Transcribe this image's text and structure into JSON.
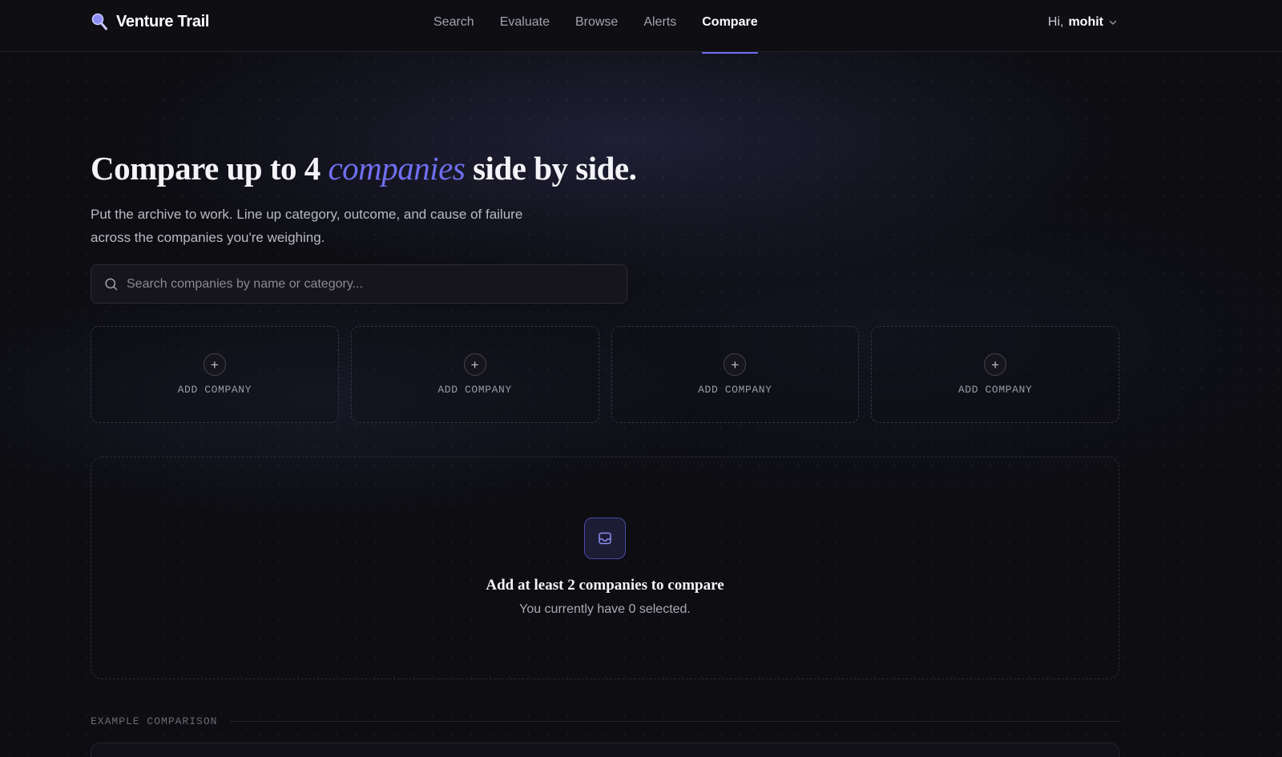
{
  "brand": {
    "name": "Venture Trail",
    "icon": "magnifier-logo-icon"
  },
  "nav": {
    "links": [
      {
        "label": "Search",
        "active": false
      },
      {
        "label": "Evaluate",
        "active": false
      },
      {
        "label": "Browse",
        "active": false
      },
      {
        "label": "Alerts",
        "active": false
      },
      {
        "label": "Compare",
        "active": true
      }
    ]
  },
  "user": {
    "greeting": "Hi,",
    "name": "mohit"
  },
  "hero": {
    "title_pre": "Compare up to 4 ",
    "title_accent": "companies",
    "title_post": " side by side.",
    "subtitle_line1": "Put the archive to work. Line up category, outcome, and cause of failure",
    "subtitle_line2": "across the companies you're weighing."
  },
  "search": {
    "placeholder": "Search companies by name or category...",
    "value": ""
  },
  "slots": [
    {
      "label": "ADD COMPANY"
    },
    {
      "label": "ADD COMPANY"
    },
    {
      "label": "ADD COMPANY"
    },
    {
      "label": "ADD COMPANY"
    }
  ],
  "empty_state": {
    "icon": "inbox-icon",
    "title": "Add at least 2 companies to compare",
    "subtitle": "You currently have 0 selected."
  },
  "example": {
    "label": "EXAMPLE COMPARISON"
  },
  "colors": {
    "accent": "#6f6ff0",
    "background": "#0d0d12",
    "nav_background": "#0e0e13"
  }
}
